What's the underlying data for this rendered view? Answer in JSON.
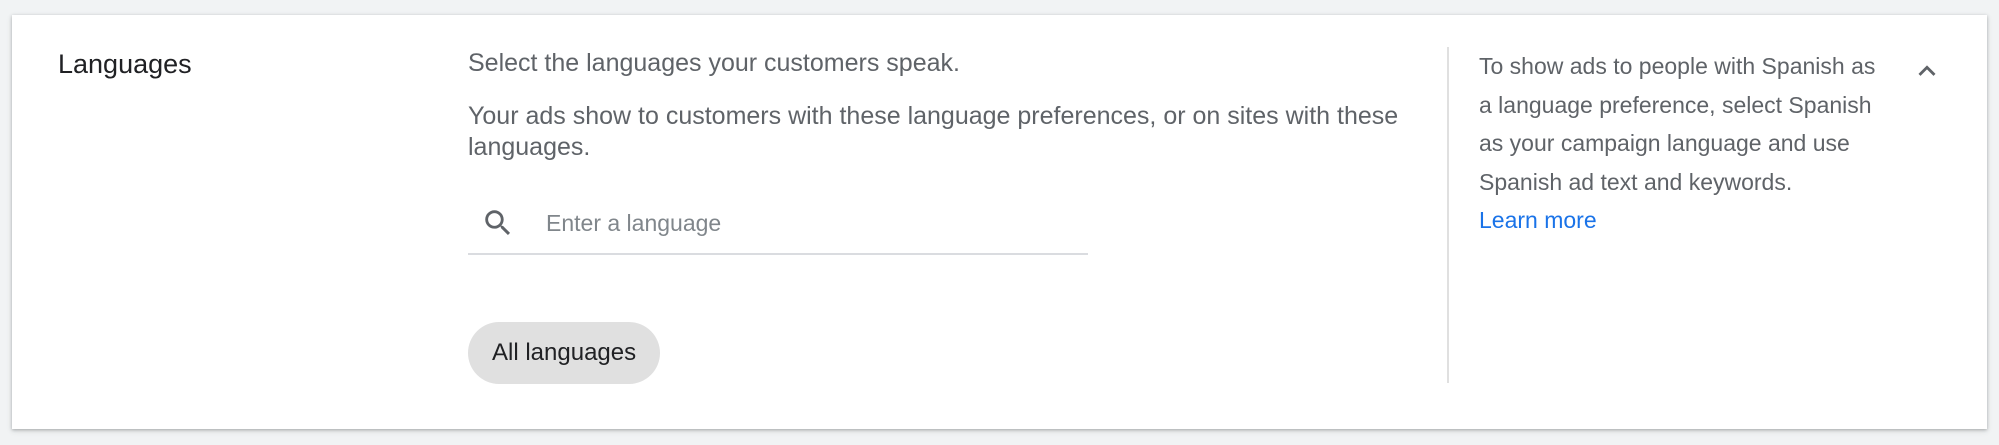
{
  "section": {
    "title": "Languages"
  },
  "main": {
    "instruction": "Select the languages your customers speak.",
    "description": "Your ads show to customers with these language preferences, or on sites with these languages.",
    "search": {
      "icon": "search-icon",
      "placeholder": "Enter a language",
      "value": ""
    },
    "selected_chip": "All languages"
  },
  "help": {
    "text": "To show ads to people with Spanish as a language preference, select Spanish as your campaign language and use Spanish ad text and keywords.",
    "link_label": "Learn more"
  },
  "controls": {
    "collapse_icon": "chevron-up-icon"
  },
  "colors": {
    "link": "#1a73e8",
    "text_primary": "#202124",
    "text_secondary": "#5f6368",
    "chip_background": "#e0e0e0"
  }
}
